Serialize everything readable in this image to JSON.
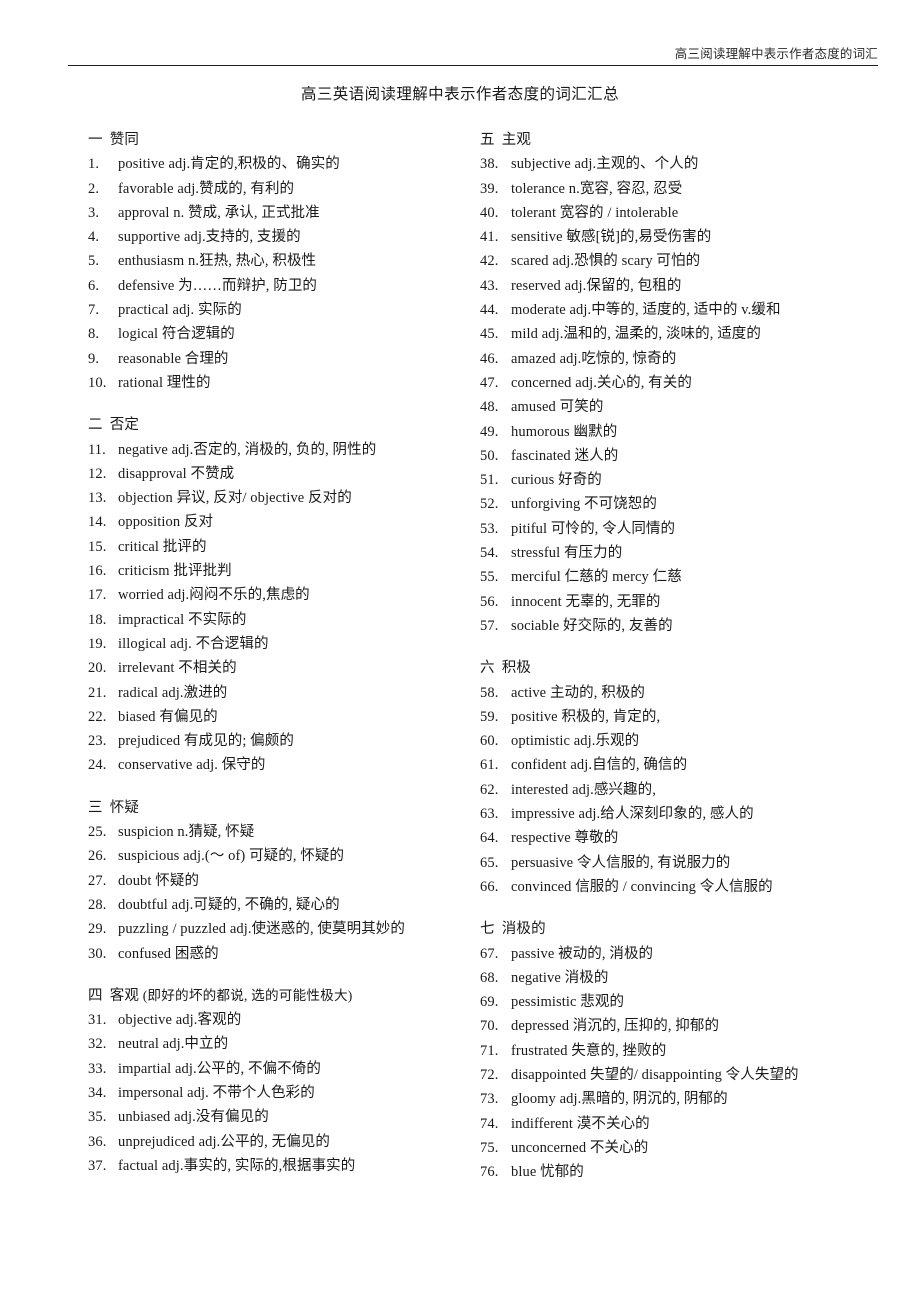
{
  "header": {
    "running_title": "高三阅读理解中表示作者态度的词汇"
  },
  "document": {
    "title": "高三英语阅读理解中表示作者态度的词汇汇总"
  },
  "columns": {
    "left": [
      {
        "number": "一",
        "name": "赞同",
        "note": "",
        "entries": [
          {
            "num": "1.",
            "text": "positive   adj.肯定的,积极的、确实的"
          },
          {
            "num": "2.",
            "text": "favorable   adj.赞成的, 有利的"
          },
          {
            "num": "3.",
            "text": "approval   n. 赞成, 承认, 正式批准"
          },
          {
            "num": "4.",
            "text": "supportive   adj.支持的, 支援的"
          },
          {
            "num": "5.",
            "text": "enthusiasm   n.狂热, 热心, 积极性"
          },
          {
            "num": "6.",
            "text": "defensive  为……而辩护, 防卫的"
          },
          {
            "num": "7.",
            "text": "practical adj. 实际的"
          },
          {
            "num": "8.",
            "text": "logical  符合逻辑的"
          },
          {
            "num": "9.",
            "text": "reasonable  合理的"
          },
          {
            "num": "10.",
            "text": "rational  理性的"
          }
        ]
      },
      {
        "number": "二",
        "name": "否定",
        "note": "",
        "entries": [
          {
            "num": "11.",
            "text": "negative   adj.否定的, 消极的, 负的, 阴性的"
          },
          {
            "num": "12.",
            "text": "disapproval  不赞成"
          },
          {
            "num": "13.",
            "text": "objection  异议, 反对/ objective  反对的"
          },
          {
            "num": "14.",
            "text": "opposition  反对"
          },
          {
            "num": "15.",
            "text": "critical  批评的"
          },
          {
            "num": "16.",
            "text": "criticism  批评批判"
          },
          {
            "num": "17.",
            "text": "worried   adj.闷闷不乐的,焦虑的"
          },
          {
            "num": "18.",
            "text": "impractical   不实际的"
          },
          {
            "num": "19.",
            "text": "illogical adj.  不合逻辑的"
          },
          {
            "num": "20.",
            "text": "irrelevant  不相关的"
          },
          {
            "num": "21.",
            "text": "radical   adj.激进的"
          },
          {
            "num": "22.",
            "text": "biased  有偏见的"
          },
          {
            "num": "23.",
            "text": "prejudiced   有成见的; 偏颇的"
          },
          {
            "num": "24.",
            "text": "conservative adj. 保守的"
          }
        ]
      },
      {
        "number": "三",
        "name": "怀疑",
        "note": "",
        "entries": [
          {
            "num": "25.",
            "text": "suspicion   n.猜疑, 怀疑"
          },
          {
            "num": "26.",
            "text": "suspicious   adj.(～ of) 可疑的, 怀疑的"
          },
          {
            "num": "27.",
            "text": "doubt  怀疑的"
          },
          {
            "num": "28.",
            "text": "doubtful   adj.可疑的, 不确的, 疑心的"
          },
          {
            "num": "29.",
            "text": "puzzling / puzzled adj.使迷惑的, 使莫明其妙的"
          },
          {
            "num": "30.",
            "text": "confused  困惑的"
          }
        ]
      },
      {
        "number": "四",
        "name": "客观",
        "note": "(即好的坏的都说, 选的可能性极大)",
        "entries": [
          {
            "num": "31.",
            "text": "objective   adj.客观的"
          },
          {
            "num": "32.",
            "text": "neutral   adj.中立的"
          },
          {
            "num": "33.",
            "text": "impartial   adj.公平的, 不偏不倚的"
          },
          {
            "num": "34.",
            "text": "impersonal   adj. 不带个人色彩的"
          },
          {
            "num": "35.",
            "text": "unbiased   adj.没有偏见的"
          },
          {
            "num": "36.",
            "text": "unprejudiced   adj.公平的, 无偏见的"
          },
          {
            "num": "37.",
            "text": "factual   adj.事实的, 实际的,根据事实的"
          }
        ]
      }
    ],
    "right": [
      {
        "number": "五",
        "name": "主观",
        "note": "",
        "entries": [
          {
            "num": "38.",
            "text": "subjective adj.主观的、个人的"
          },
          {
            "num": "39.",
            "text": "tolerance n.宽容, 容忍, 忍受"
          },
          {
            "num": "40.",
            "text": "tolerant  宽容的 / intolerable"
          },
          {
            "num": "41.",
            "text": "sensitive  敏感[锐]的,易受伤害的"
          },
          {
            "num": "42.",
            "text": "scared   adj.恐惧的  scary  可怕的"
          },
          {
            "num": "43.",
            "text": "reserved   adj.保留的, 包租的"
          },
          {
            "num": "44.",
            "text": "moderate   adj.中等的, 适度的, 适中的 v.缓和"
          },
          {
            "num": "45.",
            "text": "mild   adj.温和的, 温柔的, 淡味的, 适度的"
          },
          {
            "num": "46.",
            "text": "amazed   adj.吃惊的, 惊奇的"
          },
          {
            "num": "47.",
            "text": "concerned   adj.关心的, 有关的"
          },
          {
            "num": "48.",
            "text": "amused  可笑的"
          },
          {
            "num": "49.",
            "text": "humorous  幽默的"
          },
          {
            "num": "50.",
            "text": "fascinated  迷人的"
          },
          {
            "num": "51.",
            "text": "curious  好奇的"
          },
          {
            "num": "52.",
            "text": "unforgiving  不可饶恕的"
          },
          {
            "num": "53.",
            "text": "pitiful  可怜的, 令人同情的"
          },
          {
            "num": "54.",
            "text": "stressful  有压力的"
          },
          {
            "num": "55.",
            "text": "merciful  仁慈的  mercy  仁慈"
          },
          {
            "num": "56.",
            "text": "innocent  无辜的, 无罪的"
          },
          {
            "num": "57.",
            "text": "sociable  好交际的, 友善的"
          }
        ]
      },
      {
        "number": "六",
        "name": "积极",
        "note": "",
        "entries": [
          {
            "num": "58.",
            "text": "active  主动的, 积极的"
          },
          {
            "num": "59.",
            "text": "positive  积极的, 肯定的,"
          },
          {
            "num": "60.",
            "text": "optimistic   adj.乐观的"
          },
          {
            "num": "61.",
            "text": "confident   adj.自信的, 确信的"
          },
          {
            "num": "62.",
            "text": "interested   adj.感兴趣的,"
          },
          {
            "num": "63.",
            "text": "impressive   adj.给人深刻印象的, 感人的"
          },
          {
            "num": "64.",
            "text": "respective  尊敬的"
          },
          {
            "num": "65.",
            "text": "persuasive  令人信服的, 有说服力的"
          },
          {
            "num": "66.",
            "text": "convinced  信服的 / convincing  令人信服的"
          }
        ]
      },
      {
        "number": "七",
        "name": "消极的",
        "note": "",
        "entries": [
          {
            "num": "67.",
            "text": "passive   被动的, 消极的"
          },
          {
            "num": "68.",
            "text": "negative  消极的"
          },
          {
            "num": "69.",
            "text": "pessimistic  悲观的"
          },
          {
            "num": "70.",
            "text": "depressed  消沉的, 压抑的, 抑郁的"
          },
          {
            "num": "71.",
            "text": "frustrated  失意的, 挫败的"
          },
          {
            "num": "72.",
            "text": "disappointed  失望的/ disappointing 令人失望的"
          },
          {
            "num": "73.",
            "text": "gloomy adj.黑暗的, 阴沉的, 阴郁的"
          },
          {
            "num": "74.",
            "text": "indifferent  漠不关心的"
          },
          {
            "num": "75.",
            "text": "unconcerned  不关心的"
          },
          {
            "num": "76.",
            "text": "blue  忧郁的"
          }
        ]
      }
    ]
  }
}
